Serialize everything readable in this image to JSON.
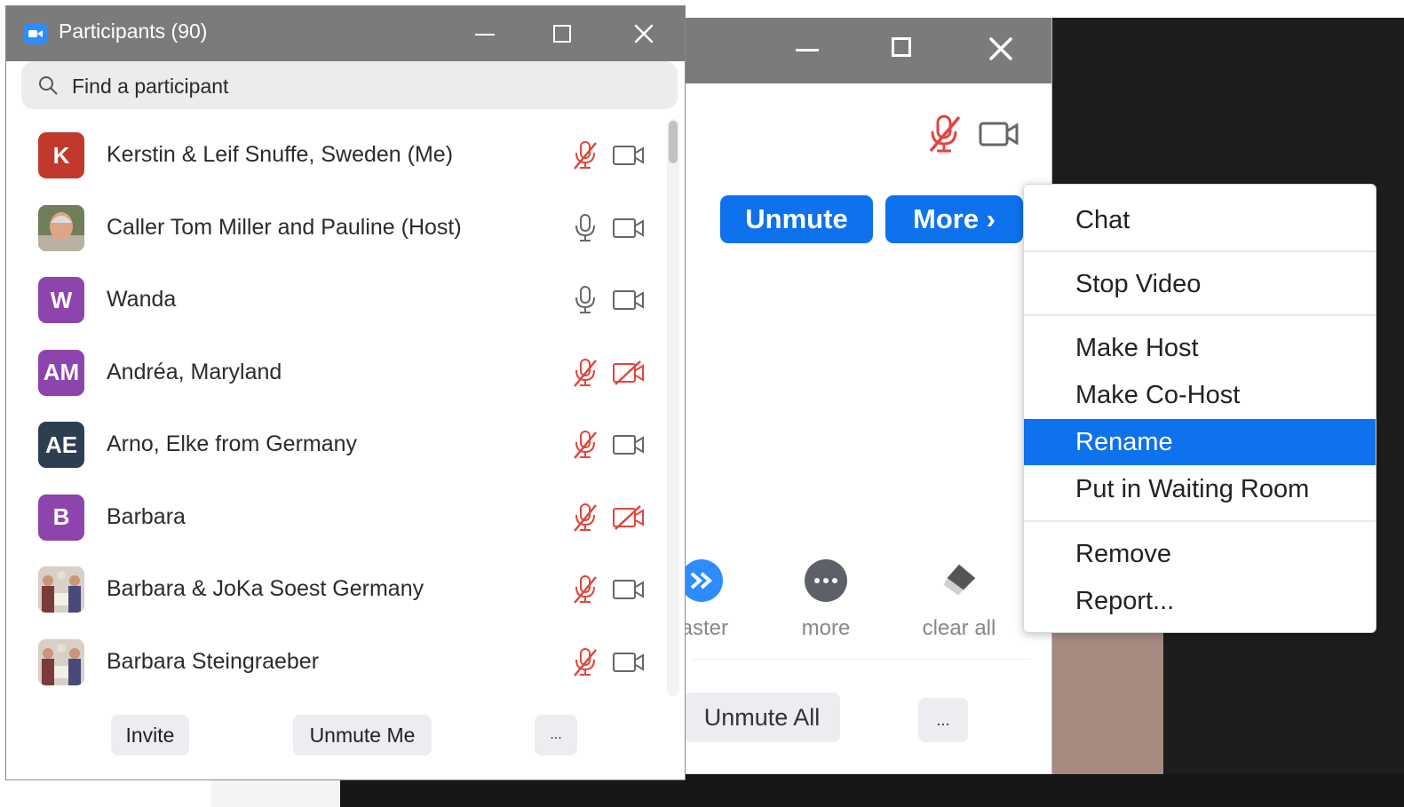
{
  "window": {
    "title": "Participants (90)"
  },
  "search": {
    "placeholder": "Find a participant"
  },
  "participants": [
    {
      "name": "Kerstin & Leif Snuffe, Sweden (Me)",
      "initials": "K",
      "avatar_color": "#c0392b",
      "avatar_type": "initials",
      "mic": "muted",
      "video": "on"
    },
    {
      "name": "Caller Tom Miller and Pauline (Host)",
      "initials": "",
      "avatar_color": "#8a7a5a",
      "avatar_type": "photo-man",
      "mic": "unmuted",
      "video": "on"
    },
    {
      "name": "Wanda",
      "initials": "W",
      "avatar_color": "#8e44ad",
      "avatar_type": "initials",
      "mic": "unmuted",
      "video": "on"
    },
    {
      "name": "Andréa, Maryland",
      "initials": "AM",
      "avatar_color": "#8e44ad",
      "avatar_type": "initials",
      "mic": "muted",
      "video": "off"
    },
    {
      "name": "Arno, Elke from Germany",
      "initials": "AE",
      "avatar_color": "#2c3e50",
      "avatar_type": "initials",
      "mic": "muted",
      "video": "on"
    },
    {
      "name": "Barbara",
      "initials": "B",
      "avatar_color": "#8e44ad",
      "avatar_type": "initials",
      "mic": "muted",
      "video": "off"
    },
    {
      "name": "Barbara & JoKa Soest Germany",
      "initials": "",
      "avatar_color": "#9a7b6a",
      "avatar_type": "photo-dance",
      "mic": "muted",
      "video": "on"
    },
    {
      "name": "Barbara Steingraeber",
      "initials": "",
      "avatar_color": "#9a7b6a",
      "avatar_type": "photo-dance",
      "mic": "muted",
      "video": "on"
    }
  ],
  "footer": {
    "invite": "Invite",
    "unmute_me": "Unmute Me",
    "more": "..."
  },
  "second_window": {
    "unmute": "Unmute",
    "more": "More ›",
    "actions": [
      {
        "label": "faster",
        "icon": "fast-forward-icon"
      },
      {
        "label": "more",
        "icon": "more-dots-icon"
      },
      {
        "label": "clear all",
        "icon": "eraser-icon"
      }
    ],
    "unmute_all": "Unmute All",
    "more_dots": "..."
  },
  "context_menu": {
    "items": [
      "Chat",
      "Stop Video",
      "Make Host",
      "Make Co-Host",
      "Rename",
      "Put in Waiting Room",
      "Remove",
      "Report..."
    ],
    "selected": "Rename"
  },
  "colors": {
    "accent": "#0e72ed",
    "muted_red": "#e2453c",
    "titlebar": "#7b7b7b"
  }
}
